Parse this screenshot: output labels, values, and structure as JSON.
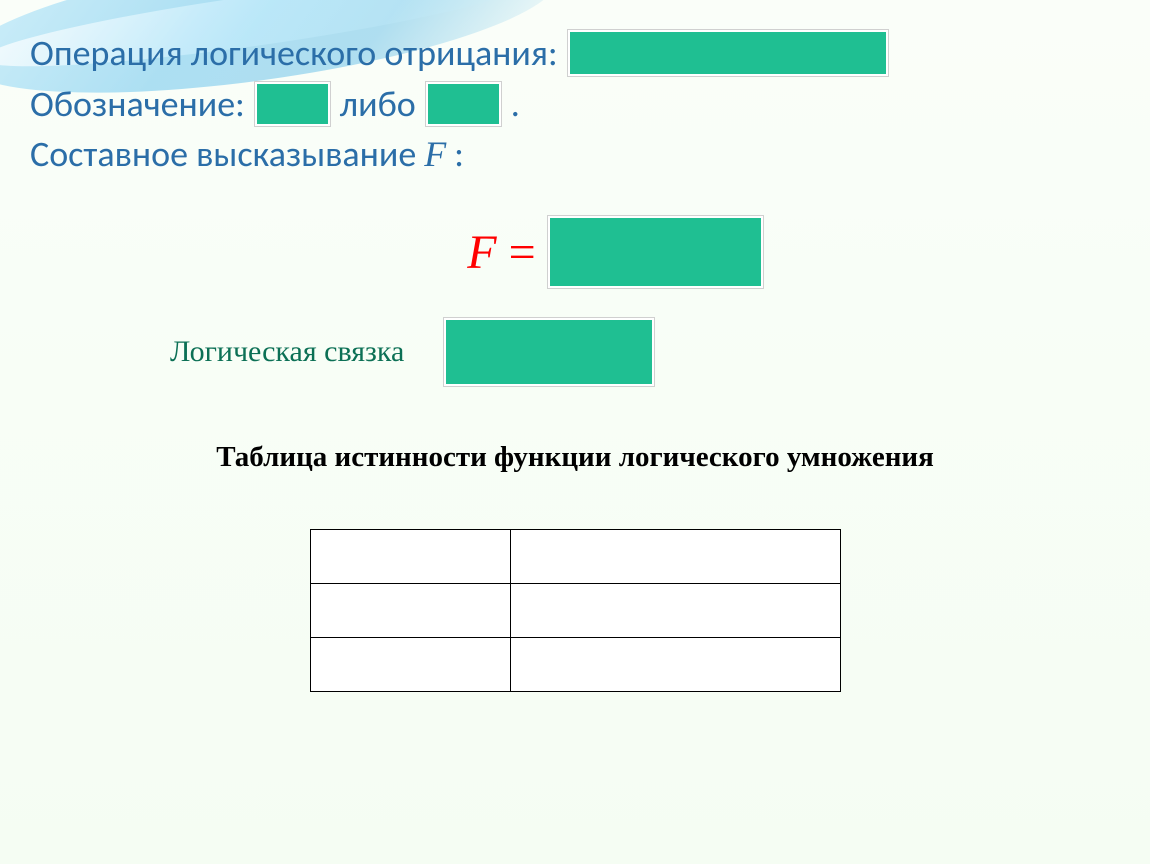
{
  "heading": {
    "operation_label": "Операция логического отрицания:",
    "notation_label": "Обозначение:",
    "notation_or": "либо",
    "notation_period": ".",
    "compound_label_part1": "Составное высказывание",
    "compound_var": "F",
    "compound_colon": ":"
  },
  "formula": {
    "var": "F",
    "eq": "="
  },
  "connective": {
    "label": "Логическая связка"
  },
  "table": {
    "title": "Таблица истинности функции логического умножения",
    "rows": 3,
    "cols": 2
  }
}
